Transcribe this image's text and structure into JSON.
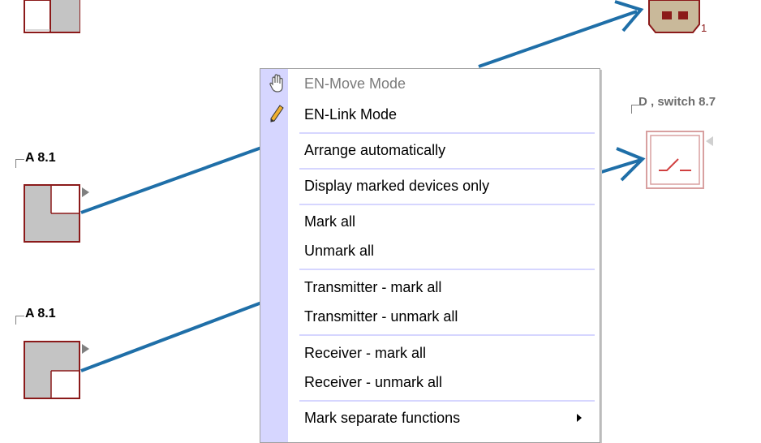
{
  "devices": {
    "top_left": {
      "label": ""
    },
    "left_1": {
      "label": "A 8.1"
    },
    "left_2": {
      "label": "A 8.1"
    },
    "right_switch": {
      "label": "D , switch 8.7"
    },
    "top_right_badge": {
      "sub": "1"
    }
  },
  "menu": {
    "items": [
      {
        "label": "EN-Move Mode",
        "icon": "hand-icon",
        "disabled": true
      },
      {
        "label": "EN-Link Mode",
        "icon": "pencil-icon",
        "disabled": false
      },
      {
        "label": "Arrange automatically"
      },
      {
        "label": "Display marked devices only"
      },
      {
        "label": "Mark all"
      },
      {
        "label": "Unmark all"
      },
      {
        "label": "Transmitter - mark all"
      },
      {
        "label": "Transmitter - unmark all"
      },
      {
        "label": "Receiver - mark all"
      },
      {
        "label": "Receiver - unmark all"
      },
      {
        "label": "Mark separate functions",
        "submenu": true
      }
    ]
  },
  "colors": {
    "link_line": "#1f6fa8",
    "device_border": "#8b1a1a",
    "menu_gutter": "#d6d6ff"
  }
}
